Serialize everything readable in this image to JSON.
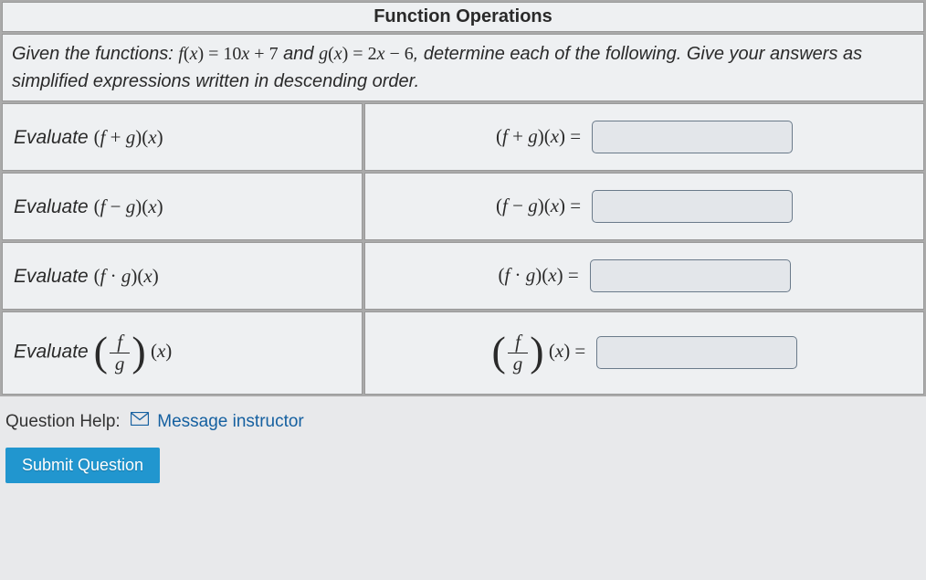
{
  "header": {
    "title": "Function Operations"
  },
  "instructions": {
    "prefix": "Given the functions: ",
    "f_def": "f(x) = 10x + 7",
    "connector": " and ",
    "g_def": "g(x) = 2x − 6",
    "suffix": ", determine each of the following. Give your answers as simplified expressions written in descending order."
  },
  "rows": [
    {
      "label_prefix": "Evaluate ",
      "op": "(f + g)(x)",
      "rhs": "(f + g)(x) ="
    },
    {
      "label_prefix": "Evaluate ",
      "op": "(f − g)(x)",
      "rhs": "(f − g)(x) ="
    },
    {
      "label_prefix": "Evaluate ",
      "op": "(f · g)(x)",
      "rhs": "(f · g)(x) ="
    },
    {
      "label_prefix": "Evaluate ",
      "op_frac_num": "f",
      "op_frac_den": "g",
      "op_arg": "(x)",
      "rhs_arg": "(x) ="
    }
  ],
  "help": {
    "label": "Question Help:",
    "link": "Message instructor"
  },
  "submit": {
    "label": "Submit Question"
  }
}
